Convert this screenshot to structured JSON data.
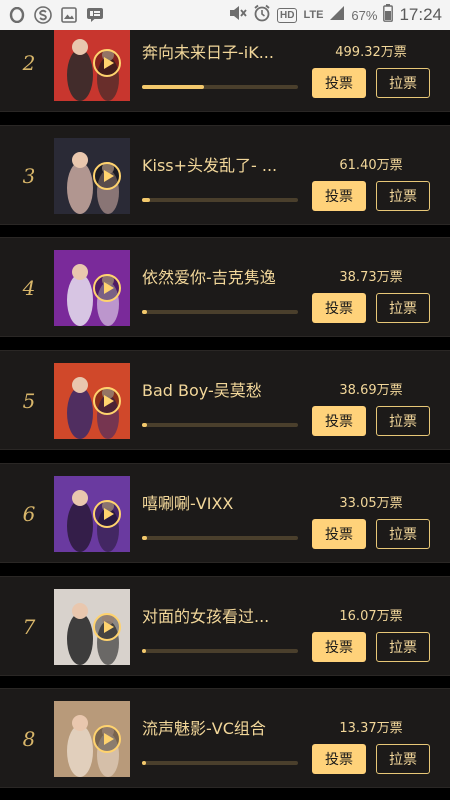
{
  "status_bar": {
    "icons": [
      "opera-icon",
      "s-browser-icon",
      "gallery-icon",
      "message-icon"
    ],
    "hd": "HD",
    "lte": "LTE",
    "battery_pct": "67%",
    "time": "17:24"
  },
  "buttons": {
    "vote": "投票",
    "pull": "拉票"
  },
  "entries": [
    {
      "rank": "2",
      "title": "奔向未来日子-iK...",
      "votes": "499.32万票",
      "progress": 0.4,
      "thumb_bg": "#c8362e",
      "thumb_fg": "#2a2a2a"
    },
    {
      "rank": "3",
      "title": "Kiss+头发乱了- ...",
      "votes": "61.40万票",
      "progress": 0.05,
      "thumb_bg": "#2a2a36",
      "thumb_fg": "#c9a9a0"
    },
    {
      "rank": "4",
      "title": "依然爱你-吉克隽逸",
      "votes": "38.73万票",
      "progress": 0.035,
      "thumb_bg": "#7a2a9a",
      "thumb_fg": "#e8e0f0"
    },
    {
      "rank": "5",
      "title": "Bad Boy-吴莫愁",
      "votes": "38.69万票",
      "progress": 0.035,
      "thumb_bg": "#d0482a",
      "thumb_fg": "#3a2a6a"
    },
    {
      "rank": "6",
      "title": "嘻唰唰-VIXX",
      "votes": "33.05万票",
      "progress": 0.03,
      "thumb_bg": "#6a3aa0",
      "thumb_fg": "#2a1a3a"
    },
    {
      "rank": "7",
      "title": "对面的女孩看过...",
      "votes": "16.07万票",
      "progress": 0.015,
      "thumb_bg": "#d8d2cc",
      "thumb_fg": "#222"
    },
    {
      "rank": "8",
      "title": "流声魅影-VC组合",
      "votes": "13.37万票",
      "progress": 0.012,
      "thumb_bg": "#b89a7a",
      "thumb_fg": "#e8d8c8"
    }
  ]
}
